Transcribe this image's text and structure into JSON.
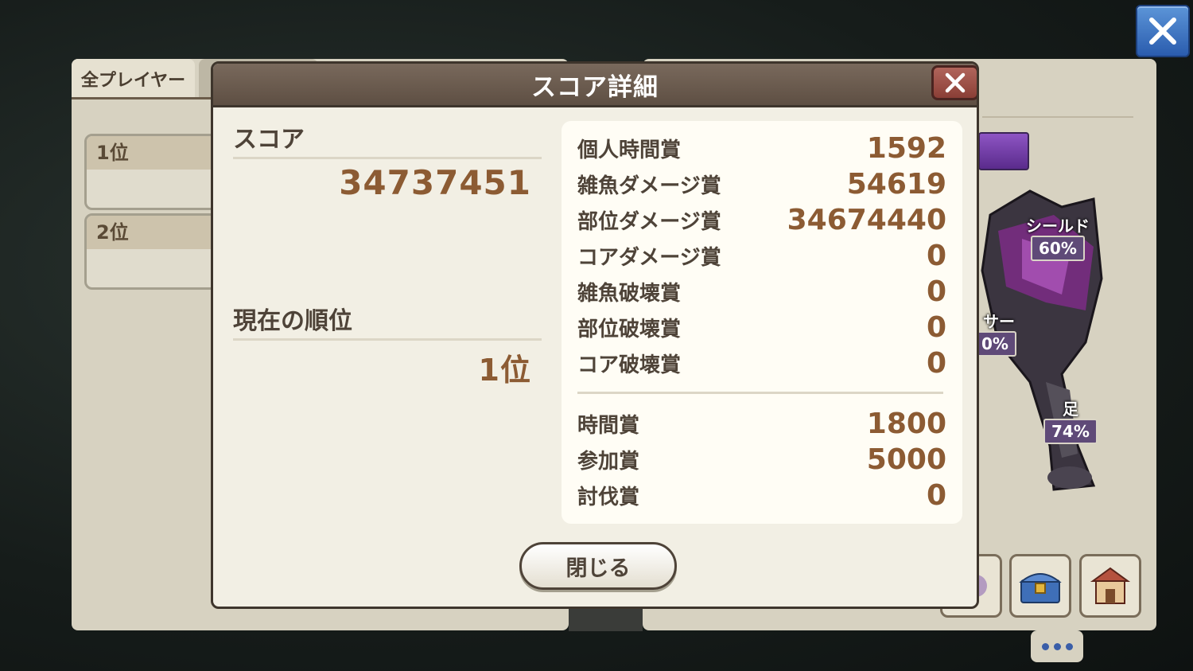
{
  "modal": {
    "title": "スコア詳細",
    "score_label": "スコア",
    "score_value": "34737451",
    "rank_label": "現在の順位",
    "rank_value": "1位",
    "breakdown": [
      {
        "label": "個人時間賞",
        "value": "1592"
      },
      {
        "label": "雑魚ダメージ賞",
        "value": "54619"
      },
      {
        "label": "部位ダメージ賞",
        "value": "34674440"
      },
      {
        "label": "コアダメージ賞",
        "value": "0"
      },
      {
        "label": "雑魚破壊賞",
        "value": "0"
      },
      {
        "label": "部位破壊賞",
        "value": "0"
      },
      {
        "label": "コア破壊賞",
        "value": "0"
      }
    ],
    "bonus": [
      {
        "label": "時間賞",
        "value": "1800"
      },
      {
        "label": "参加賞",
        "value": "5000"
      },
      {
        "label": "討伐賞",
        "value": "0"
      }
    ],
    "close_button": "閉じる"
  },
  "background": {
    "tab_all_players": "全プレイヤー",
    "ranks": [
      "1位",
      "2位"
    ],
    "boss_parts": [
      {
        "name": "シールド",
        "percent": "60%"
      },
      {
        "name": "サー",
        "percent": "0%"
      },
      {
        "name": "足",
        "percent": "74%"
      }
    ]
  },
  "colors": {
    "modal_header": "#6b5b4f",
    "value_brown": "#8c5b33",
    "close_red": "#9c4b42",
    "top_close_blue": "#3d72c4"
  }
}
